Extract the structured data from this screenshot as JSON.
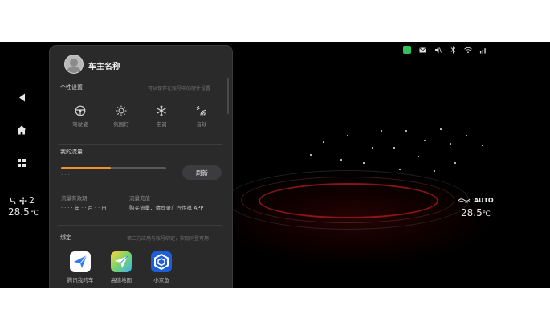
{
  "status_bar": {
    "icons": [
      "carplay-icon",
      "message-icon",
      "mute-icon",
      "bluetooth-icon",
      "wifi-icon",
      "signal-icon"
    ]
  },
  "dock": {
    "fan_level": "2",
    "left_temp": "28.5",
    "temp_unit": "℃"
  },
  "climate_right": {
    "mode": "AUTO",
    "temp": "28.5",
    "unit": "℃"
  },
  "panel": {
    "owner_name": "车主名称",
    "preferences": {
      "title": "个性设置",
      "hint": "可以保存在账号中的硬件设置",
      "items": [
        {
          "label": "驾驶姿",
          "icon": "steering-wheel-icon"
        },
        {
          "label": "氛围灯",
          "icon": "ambient-light-icon"
        },
        {
          "label": "空调",
          "icon": "snowflake-icon"
        },
        {
          "label": "音效",
          "icon": "sound-effect-icon"
        }
      ]
    },
    "data_usage": {
      "title": "我的流量",
      "amount": "· · ·",
      "progress_fraction": 0.47,
      "refresh_label": "刷新",
      "validity_label": "流量有效期",
      "validity_value": "· · · · 年 · · 月 · · 日",
      "topup_label": "流量充值",
      "topup_value": "购买流量，请登录广汽传祺 APP"
    },
    "binding": {
      "title": "绑定",
      "hint": "第三方应用与账号绑定，实现同登可用",
      "apps": [
        {
          "label": "腾讯我的车",
          "icon": "tencent-car-icon"
        },
        {
          "label": "高德地图",
          "icon": "amap-icon"
        },
        {
          "label": "小京鱼",
          "icon": "xiaojingyu-icon"
        }
      ]
    }
  },
  "colors": {
    "accent": "#f0902f",
    "panel_bg": "#2a2a2b",
    "screen_bg": "#000000"
  }
}
